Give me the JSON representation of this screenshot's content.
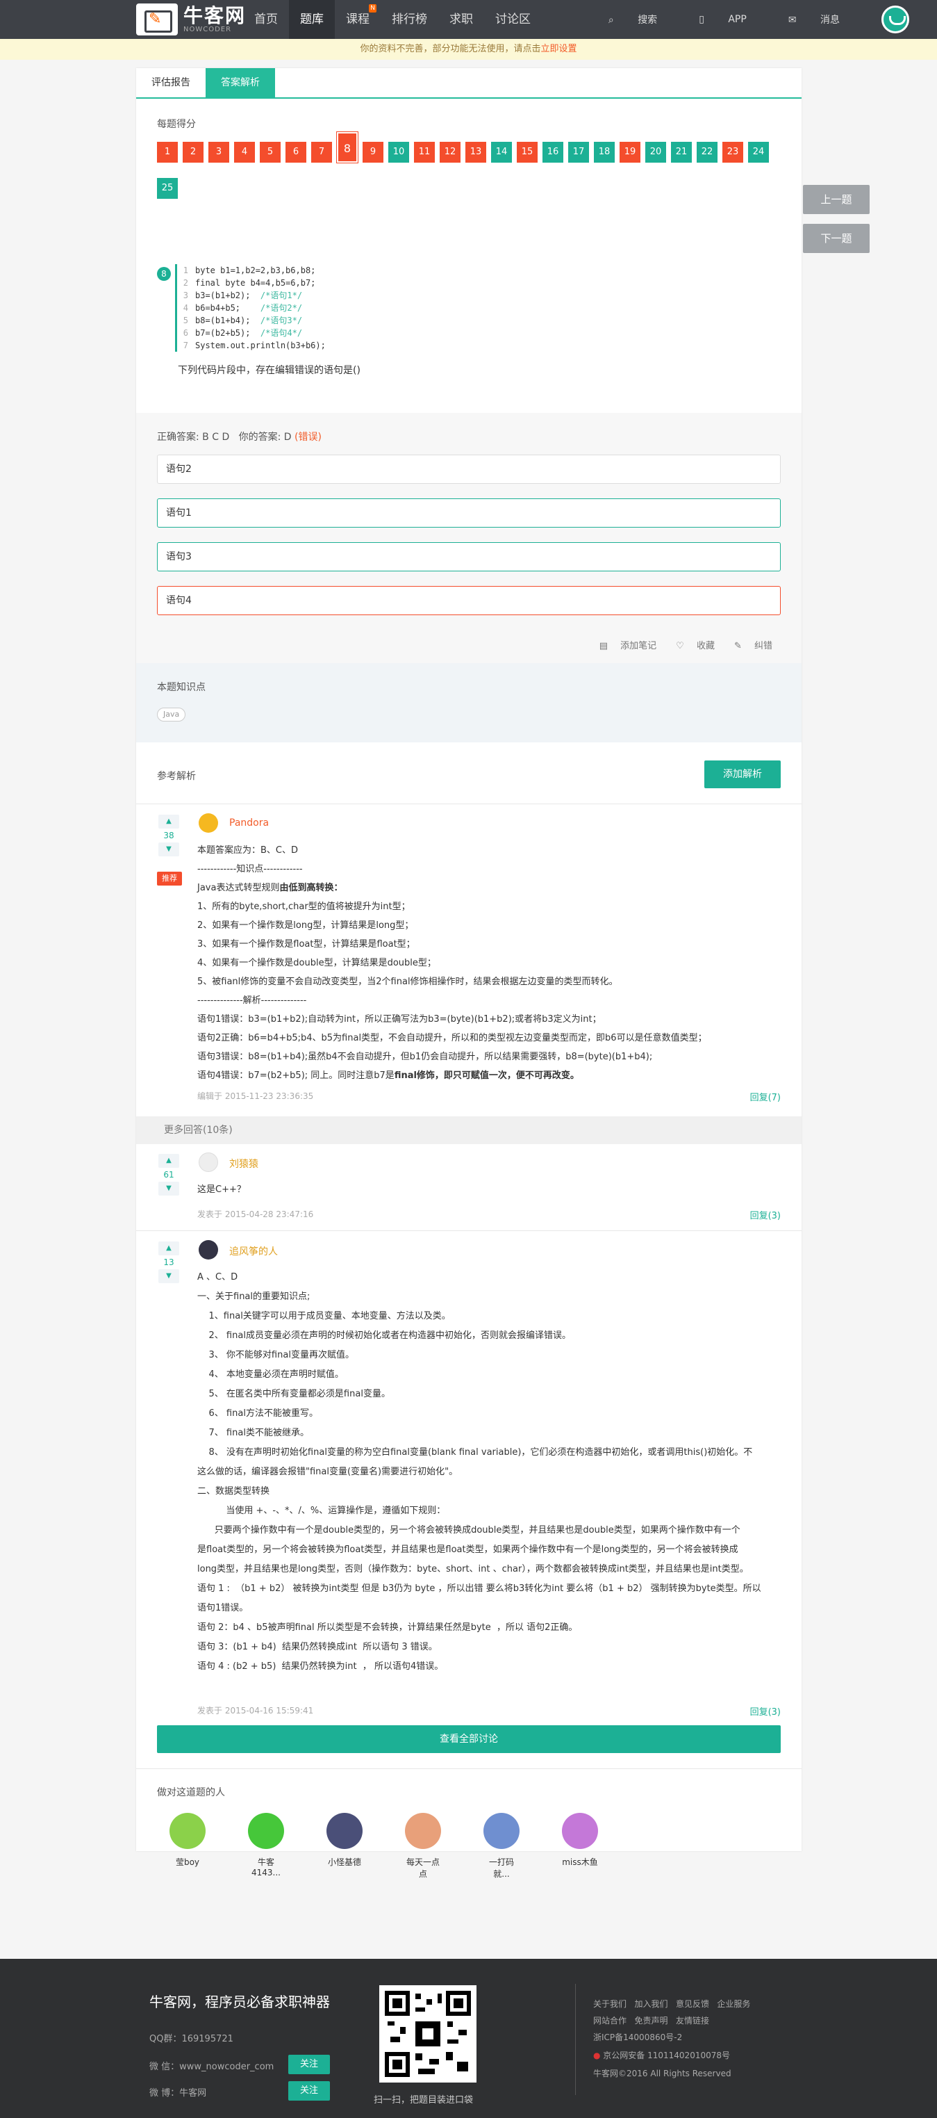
{
  "nav": {
    "brand": "牛客网",
    "brand_sub": "NOWCODER",
    "items": [
      {
        "label": "首页"
      },
      {
        "label": "题库"
      },
      {
        "label": "课程"
      },
      {
        "label": "排行榜"
      },
      {
        "label": "求职"
      },
      {
        "label": "讨论区"
      }
    ],
    "course_badge": "N",
    "search": "搜索",
    "app": "APP",
    "msg": "消息"
  },
  "notice": {
    "text": "你的资料不完善，部分功能无法使用，请点击",
    "link": "立即设置"
  },
  "tabs": [
    {
      "label": "评估报告"
    },
    {
      "label": "答案解析"
    }
  ],
  "score": {
    "label": "每题得分",
    "items": [
      "1",
      "2",
      "3",
      "4",
      "5",
      "6",
      "7",
      "8",
      "9",
      "10",
      "11",
      "12",
      "13",
      "14",
      "15",
      "16",
      "17",
      "18",
      "19",
      "20",
      "21",
      "22",
      "23",
      "24",
      "25"
    ],
    "status": [
      "r",
      "r",
      "r",
      "r",
      "r",
      "r",
      "r",
      "r",
      "r",
      "g",
      "r",
      "r",
      "r",
      "g",
      "r",
      "g",
      "g",
      "g",
      "r",
      "g",
      "g",
      "g",
      "r",
      "g",
      "g"
    ]
  },
  "side": {
    "prev": "上一题",
    "next": "下一题"
  },
  "question": {
    "num": "8",
    "code": [
      {
        "n": "1",
        "c": "byte b1=1,b2=2,b3,b6,b8;",
        "m": ""
      },
      {
        "n": "2",
        "c": "final byte b4=4,b5=6,b7;",
        "m": ""
      },
      {
        "n": "3",
        "c": "b3=(b1+b2);  ",
        "m": "/*语句1*/"
      },
      {
        "n": "4",
        "c": "b6=b4+b5;    ",
        "m": "/*语句2*/"
      },
      {
        "n": "5",
        "c": "b8=(b1+b4);  ",
        "m": "/*语句3*/"
      },
      {
        "n": "6",
        "c": "b7=(b2+b5);  ",
        "m": "/*语句4*/"
      },
      {
        "n": "7",
        "c": "System.out.println(b3+b6);",
        "m": ""
      }
    ],
    "text": "下列代码片段中，存在编辑错误的语句是()"
  },
  "answer": {
    "correct_label": "正确答案: B C D",
    "yours_label": "你的答案: D",
    "wrong": "(错误)",
    "options": [
      "语句2",
      "语句1",
      "语句3",
      "语句4"
    ]
  },
  "tools": {
    "note": "添加笔记",
    "fav": "收藏",
    "fix": "纠错"
  },
  "knowledge": {
    "title": "本题知识点",
    "tag": "Java"
  },
  "explain": {
    "title": "参考解析",
    "add": "添加解析",
    "top": {
      "votes": "38",
      "badge": "推荐",
      "user": "Pandora",
      "lines": [
        "本题答案应为：B、C、D",
        "------------知识点------------",
        "Java表达式转型规则由低到高转换：",
        "1、所有的byte,short,char型的值将被提升为int型；",
        "2、如果有一个操作数是long型，计算结果是long型；",
        "3、如果有一个操作数是float型，计算结果是float型；",
        "4、如果有一个操作数是double型，计算结果是double型；",
        "5、被fianl修饰的变量不会自动改变类型，当2个final修饰相操作时，结果会根据左边变量的类型而转化。",
        "--------------解析--------------",
        "语句1错误：b3=(b1+b2);自动转为int，所以正确写法为b3=(byte)(b1+b2);或者将b3定义为int；",
        "语句2正确：b6=b4+b5;b4、b5为final类型，不会自动提升，所以和的类型视左边变量类型而定，即b6可以是任意数值类型；",
        "语句3错误：b8=(b1+b4);虽然b4不会自动提升，但b1仍会自动提升，所以结果需要强转，b8=(byte)(b1+b4);",
        "语句4错误：b7=(b2+b5); 同上。同时注意b7是final修饰，即只可赋值一次，便不可再改变。"
      ],
      "bold3": "由低到高转换：",
      "bold_last": "final修饰，即只可赋值一次，便不可再改变。",
      "time": "编辑于 2015-11-23 23:36:35",
      "reply": "回复(7)"
    },
    "more": "更多回答(10条)",
    "a2": {
      "votes": "61",
      "user": "刘猿猿",
      "text": "这是C++？",
      "time": "发表于 2015-04-28 23:47:16",
      "reply": "回复(3)"
    },
    "a3": {
      "votes": "13",
      "user": "追风筝的人",
      "lines": [
        "A 、C、D",
        "一、关于final的重要知识点;",
        "    1、final关键字可以用于成员变量、本地变量、方法以及类。",
        "    2、 final成员变量必须在声明的时候初始化或者在构造器中初始化，否则就会报编译错误。",
        "    3、 你不能够对final变量再次赋值。",
        "    4、 本地变量必须在声明时赋值。",
        "    5、 在匿名类中所有变量都必须是final变量。",
        "    6、 final方法不能被重写。",
        "    7、 final类不能被继承。",
        "    8、 没有在声明时初始化final变量的称为空白final变量(blank final variable)，它们必须在构造器中初始化，或者调用this()初始化。不",
        "这么做的话，编译器会报错\"final变量(变量名)需要进行初始化\"。",
        "二、数据类型转换",
        "          当使用 +、-、*、/、%、运算操作是，遵循如下规则：",
        "      只要两个操作数中有一个是double类型的，另一个将会被转换成double类型，并且结果也是double类型，如果两个操作数中有一个",
        "是float类型的，另一个将会被转换为float类型，并且结果也是float类型，如果两个操作数中有一个是long类型的，另一个将会被转换成",
        "long类型，并且结果也是long类型，否则（操作数为：byte、short、int 、char），两个数都会被转换成int类型，并且结果也是int类型。",
        "语句 1 :  （b1 + b2） 被转换为int类型 但是 b3仍为 byte ，所以出错 要么将b3转化为int 要么将（b1 + b2） 强制转换为byte类型。所以",
        "语句1错误。",
        "语句 2：b4 、b5被声明final 所以类型是不会转换，计算结果任然是byte  ，所以 语句2正确。",
        "语句 3：(b1 + b4)  结果仍然转换成int  所以语句 3 错误。",
        "语句 4 : (b2 + b5)  结果仍然转换为int  ， 所以语句4错误。"
      ],
      "time": "发表于 2015-04-16 15:59:41",
      "reply": "回复(3)"
    },
    "all": "查看全部讨论"
  },
  "users": {
    "title": "做对这道题的人",
    "list": [
      {
        "name": "莹boy",
        "c": "#8bd14a"
      },
      {
        "name": "牛客4143...",
        "c": "#46c73a"
      },
      {
        "name": "小怪基德",
        "c": "#4a4f78"
      },
      {
        "name": "每天一点点",
        "c": "#e8a07a"
      },
      {
        "name": "一打码就...",
        "c": "#6f8fd0"
      },
      {
        "name": "miss木鱼",
        "c": "#c478d8"
      }
    ]
  },
  "footer": {
    "title": "牛客网，程序员必备求职神器",
    "qq": "QQ群：169195721",
    "wechat": "微 信：www_nowcoder_com",
    "weibo": "微 博：牛客网",
    "follow": "关注",
    "qr_caption": "扫一扫，把题目装进口袋",
    "links": [
      "关于我们",
      "加入我们",
      "意见反馈",
      "企业服务"
    ],
    "links2": [
      "网站合作",
      "免责声明",
      "友情链接"
    ],
    "icp": "浙ICP备14000860号-2",
    "police": "京公网安备 11011402010078号",
    "copy": "牛客网©2016 All Rights Reserved"
  }
}
